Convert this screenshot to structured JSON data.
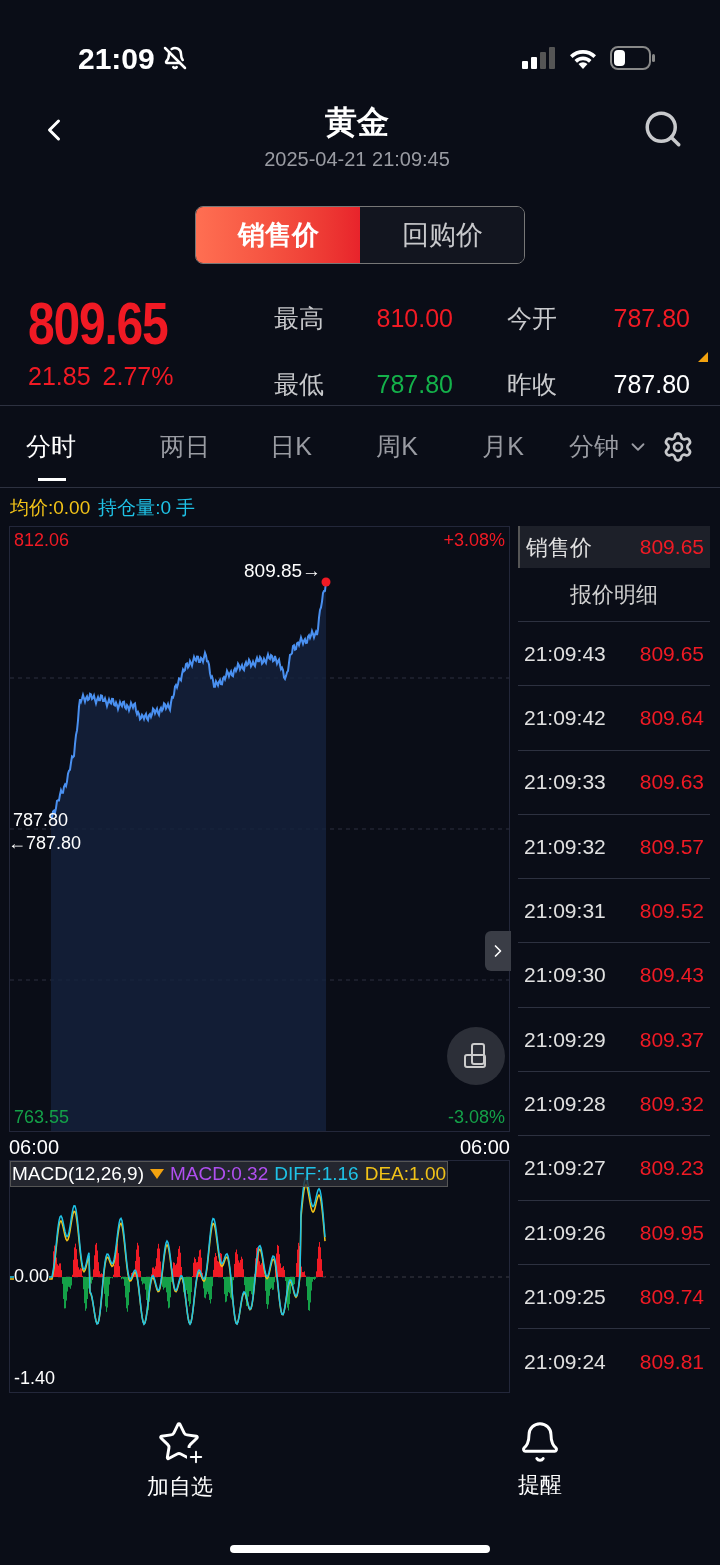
{
  "status_bar": {
    "time": "21:09"
  },
  "header": {
    "title": "黄金",
    "timestamp": "2025-04-21 21:09:45"
  },
  "price_tabs": [
    {
      "label": "销售价",
      "selected": true
    },
    {
      "label": "回购价",
      "selected": false
    }
  ],
  "quote": {
    "price": "809.65",
    "change": "21.85",
    "change_pct": "2.77%",
    "stats": [
      {
        "label": "最高",
        "value": "810.00",
        "color": "#f01a24"
      },
      {
        "label": "今开",
        "value": "787.80",
        "color": "#f01a24"
      },
      {
        "label": "最低",
        "value": "787.80",
        "color": "#14b14a"
      },
      {
        "label": "昨收",
        "value": "787.80",
        "color": "#ffffff"
      }
    ]
  },
  "period_tabs": [
    {
      "label": "分时",
      "selected": true
    },
    {
      "label": "两日",
      "selected": false
    },
    {
      "label": "日K",
      "selected": false
    },
    {
      "label": "周K",
      "selected": false
    },
    {
      "label": "月K",
      "selected": false
    },
    {
      "label": "分钟",
      "selected": false
    }
  ],
  "chart_info": {
    "avg_price": "均价:0.00",
    "open_interest": "持仓量:0 手"
  },
  "price_chart": {
    "high": "812.06",
    "high_pct": "+3.08%",
    "last_marker": "809.85→",
    "base": "787.80",
    "base_marker": "←787.80",
    "low": "763.55",
    "low_pct": "-3.08%",
    "time_start": "06:00",
    "time_end": "06:00"
  },
  "macd": {
    "title": "MACD(12,26,9)",
    "macd": "MACD:0.32",
    "diff": "DIFF:1.16",
    "dea": "DEA:1.00",
    "zero": "0.00",
    "min": "-1.40"
  },
  "quote_panel": {
    "label": "销售价",
    "value": "809.65",
    "title": "报价明细",
    "rows": [
      {
        "time": "21:09:43",
        "price": "809.65"
      },
      {
        "time": "21:09:42",
        "price": "809.64"
      },
      {
        "time": "21:09:33",
        "price": "809.63"
      },
      {
        "time": "21:09:32",
        "price": "809.57"
      },
      {
        "time": "21:09:31",
        "price": "809.52"
      },
      {
        "time": "21:09:30",
        "price": "809.43"
      },
      {
        "time": "21:09:29",
        "price": "809.37"
      },
      {
        "time": "21:09:28",
        "price": "809.32"
      },
      {
        "time": "21:09:27",
        "price": "809.23"
      },
      {
        "time": "21:09:26",
        "price": "809.95"
      },
      {
        "time": "21:09:25",
        "price": "809.74"
      },
      {
        "time": "21:09:24",
        "price": "809.81"
      }
    ]
  },
  "bottom_nav": [
    {
      "label": "加自选",
      "kind": "star"
    },
    {
      "label": "提醒",
      "kind": "bell"
    }
  ]
}
